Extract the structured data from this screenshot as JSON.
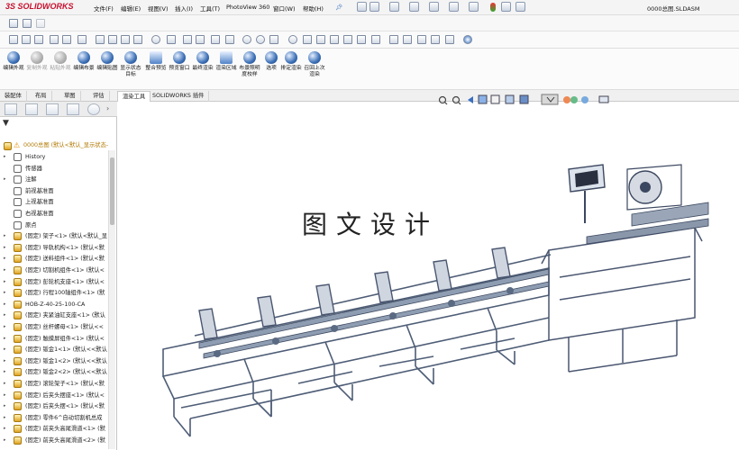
{
  "app": {
    "logo_ds": "3S",
    "logo_text": "SOLIDWORKS",
    "title": "0000总图.SLDASM"
  },
  "menu": [
    {
      "label": "文件(F)"
    },
    {
      "label": "编辑(E)"
    },
    {
      "label": "视图(V)"
    },
    {
      "label": "插入(I)"
    },
    {
      "label": "工具(T)"
    },
    {
      "label": "PhotoView 360"
    },
    {
      "label": "窗口(W)"
    },
    {
      "label": "帮助(H)"
    }
  ],
  "ribbon": {
    "buttons": [
      {
        "label": "编辑外观",
        "enabled": true
      },
      {
        "label": "复制外观",
        "enabled": false
      },
      {
        "label": "粘贴外观",
        "enabled": false
      },
      {
        "label": "编辑布景",
        "enabled": true
      },
      {
        "label": "编辑贴图",
        "enabled": true
      },
      {
        "label": "显示状态目标",
        "enabled": true
      },
      {
        "label": "整合预览",
        "enabled": true
      },
      {
        "label": "预览窗口",
        "enabled": true
      },
      {
        "label": "最终渲染",
        "enabled": true
      },
      {
        "label": "渲染区域",
        "enabled": true
      },
      {
        "label": "布景照明度校样",
        "enabled": true
      },
      {
        "label": "选项",
        "enabled": true
      },
      {
        "label": "排定渲染",
        "enabled": true
      },
      {
        "label": "召回上次渲染",
        "enabled": true
      }
    ]
  },
  "tabs": [
    {
      "label": "装配体",
      "active": false
    },
    {
      "label": "布局",
      "active": false
    },
    {
      "label": "草图",
      "active": false
    },
    {
      "label": "评估",
      "active": false
    },
    {
      "label": "渲染工具",
      "active": true
    },
    {
      "label": "SOLIDWORKS 插件",
      "active": false
    }
  ],
  "tree": {
    "root": "0000总图 (默认<默认_显示状态-1>)",
    "items": [
      {
        "label": "History",
        "arrow": "▸",
        "icon": "history-icon"
      },
      {
        "label": "传感器",
        "arrow": "",
        "icon": "sensor-icon"
      },
      {
        "label": "注解",
        "arrow": "▸",
        "icon": "annotation-icon"
      },
      {
        "label": "前视基准面",
        "arrow": "",
        "icon": "plane-icon"
      },
      {
        "label": "上视基准面",
        "arrow": "",
        "icon": "plane-icon"
      },
      {
        "label": "右视基准面",
        "arrow": "",
        "icon": "plane-icon"
      },
      {
        "label": "原点",
        "arrow": "",
        "icon": "origin-icon"
      },
      {
        "label": "(固定) 架子<1> (默认<默认_显",
        "arrow": "▸",
        "icon": "assembly-icon"
      },
      {
        "label": "(固定) 导轨机构<1> (默认<默",
        "arrow": "▸",
        "icon": "assembly-icon"
      },
      {
        "label": "(固定) 送料组件<1> (默认<默",
        "arrow": "▸",
        "icon": "assembly-icon"
      },
      {
        "label": "(固定) 切割机组件<1> (默认<",
        "arrow": "▸",
        "icon": "assembly-icon"
      },
      {
        "label": "(固定) 彭轮机支座<1> (默认<",
        "arrow": "▸",
        "icon": "assembly-icon"
      },
      {
        "label": "(固定) 行程100轴组件<1> (默",
        "arrow": "▸",
        "icon": "assembly-icon"
      },
      {
        "label": "HOB-Z-40-25-100-CA",
        "arrow": "▸",
        "icon": "assembly-icon"
      },
      {
        "label": "(固定) 夹紧油缸支座<1> (默认",
        "arrow": "▸",
        "icon": "assembly-icon"
      },
      {
        "label": "(固定) 丝杆螺母<1> (默认<<",
        "arrow": "▸",
        "icon": "assembly-icon"
      },
      {
        "label": "(固定) 触摸屏组件<1> (默认<",
        "arrow": "▸",
        "icon": "assembly-icon"
      },
      {
        "label": "(固定) 钣金1<1> (默认<<默认",
        "arrow": "▸",
        "icon": "part-icon"
      },
      {
        "label": "(固定) 钣金1<2> (默认<<默认",
        "arrow": "▸",
        "icon": "part-icon"
      },
      {
        "label": "(固定) 钣金2<2> (默认<<默认",
        "arrow": "▸",
        "icon": "part-icon"
      },
      {
        "label": "(固定) 滚轮架子<1> (默认<默",
        "arrow": "▸",
        "icon": "assembly-icon"
      },
      {
        "label": "(固定) 后夹头摆座<1> (默认<",
        "arrow": "▸",
        "icon": "assembly-icon"
      },
      {
        "label": "(固定) 后夹头摆<1> (默认<默",
        "arrow": "▸",
        "icon": "assembly-icon"
      },
      {
        "label": "(固定) 零件6^自动切割机总成",
        "arrow": "▸",
        "icon": "part-icon"
      },
      {
        "label": "(固定) 前夹头高尾滑道<1> (默",
        "arrow": "▸",
        "icon": "assembly-icon"
      },
      {
        "label": "(固定) 前夹头高尾滑道<2> (默",
        "arrow": "▸",
        "icon": "assembly-icon"
      }
    ]
  },
  "watermark": "图文设计",
  "colors": {
    "brand_red": "#c8102e",
    "frame_blue_gray": "#5a6a84",
    "tree_root": "#b07800"
  }
}
